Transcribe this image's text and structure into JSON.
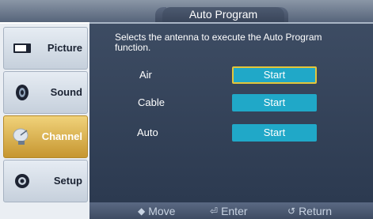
{
  "header": {
    "title": "Auto Program"
  },
  "sidebar": {
    "items": [
      {
        "label": "Picture",
        "icon": "picture-icon",
        "active": false
      },
      {
        "label": "Sound",
        "icon": "speaker-icon",
        "active": false
      },
      {
        "label": "Channel",
        "icon": "satellite-dish-icon",
        "active": true
      },
      {
        "label": "Setup",
        "icon": "gear-icon",
        "active": false
      }
    ]
  },
  "main": {
    "description": "Selects the antenna to execute the Auto Program function.",
    "options": [
      {
        "label": "Air",
        "button": "Start",
        "focused": true
      },
      {
        "label": "Cable",
        "button": "Start",
        "focused": false
      },
      {
        "label": "Auto",
        "button": "Start",
        "focused": false
      }
    ]
  },
  "footer": {
    "move_icon": "up-down-arrows-icon",
    "move": "Move",
    "enter_icon": "enter-icon",
    "enter": "Enter",
    "return_icon": "return-icon",
    "return": "Return"
  },
  "colors": {
    "panel": "#34435a",
    "button": "#20a8c8",
    "focus_border": "#e3c63a",
    "active_menu": "#dcae4d"
  }
}
